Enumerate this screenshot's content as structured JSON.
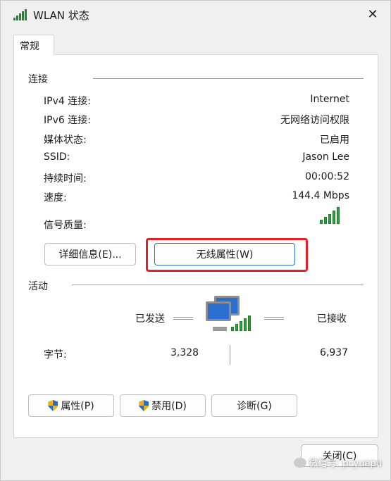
{
  "window": {
    "title": "WLAN 状态",
    "close_glyph": "✕"
  },
  "tab": {
    "label": "常规"
  },
  "connection": {
    "section_title": "连接",
    "rows": [
      {
        "label": "IPv4 连接:",
        "value": "Internet"
      },
      {
        "label": "IPv6 连接:",
        "value": "无网络访问权限"
      },
      {
        "label": "媒体状态:",
        "value": "已启用"
      },
      {
        "label": "SSID:",
        "value": "Jason Lee"
      },
      {
        "label": "持续时间:",
        "value": "00:00:52"
      },
      {
        "label": "速度:",
        "value": "144.4 Mbps"
      }
    ],
    "signal_label": "信号质量:",
    "signal_bars": 5,
    "details_button": "详细信息(E)...",
    "wireless_button": "无线属性(W)"
  },
  "activity": {
    "section_title": "活动",
    "sent_label": "已发送",
    "received_label": "已接收",
    "bytes_label": "字节:",
    "bytes_sent": "3,328",
    "bytes_received": "6,937"
  },
  "buttons": {
    "properties": "属性(P)",
    "disable": "禁用(D)",
    "diagnose": "诊断(G)",
    "close": "关闭(C)"
  },
  "watermark": {
    "text": "微信号: pcyuepu"
  },
  "colors": {
    "signal_green": "#29a33a",
    "highlight_red": "#e0202a",
    "primary_border": "#2a6fb8"
  }
}
